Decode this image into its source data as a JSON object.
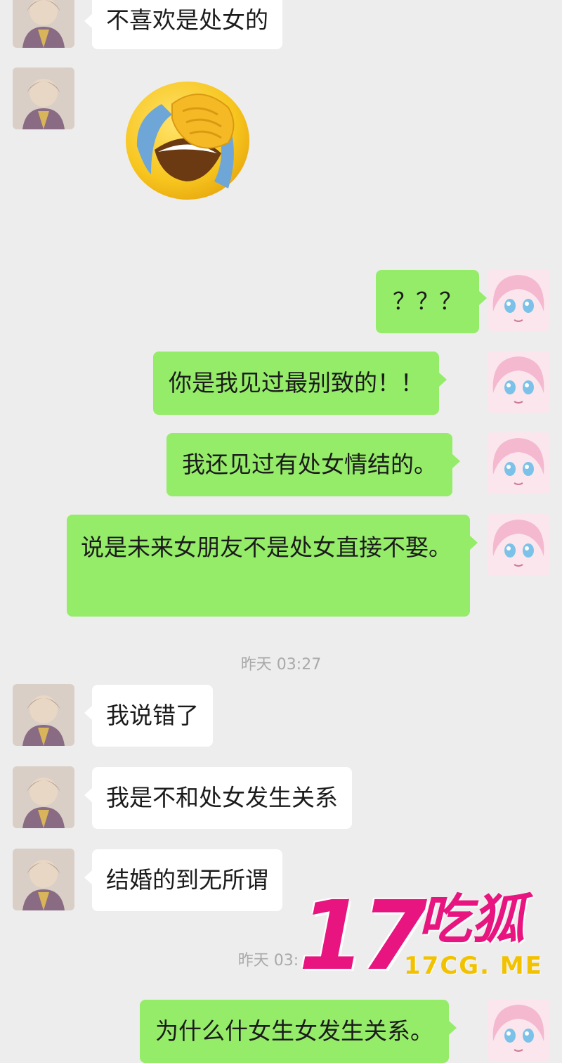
{
  "conversation": {
    "messages": [
      {
        "sender": "contact",
        "text": "不喜欢是处女的"
      },
      {
        "sender": "contact",
        "sticker": "facepalm-laugh-emoji"
      },
      {
        "sender": "me",
        "text": "？？？"
      },
      {
        "sender": "me",
        "text": "你是我见过最别致的！！"
      },
      {
        "sender": "me",
        "text": "我还见过有处女情结的。"
      },
      {
        "sender": "me",
        "text": "说是未来女朋友不是处女直接不娶。"
      },
      {
        "sender": "contact",
        "text": "我说错了"
      },
      {
        "sender": "contact",
        "text": "我是不和处女发生关系"
      },
      {
        "sender": "contact",
        "text": "结婚的到无所谓"
      },
      {
        "sender": "me",
        "text": "为什么什女生女发生关系。"
      }
    ],
    "timestamps": [
      {
        "text": "昨天 03:27"
      },
      {
        "text": "昨天 03:"
      }
    ]
  },
  "watermark": {
    "number": "17",
    "chinese": "吃狐",
    "url": "17CG. ME"
  },
  "colors": {
    "background": "#ededed",
    "incoming_bubble": "#ffffff",
    "outgoing_bubble": "#95ec69",
    "watermark_pink": "#e8147f",
    "watermark_yellow": "#f2c200"
  }
}
